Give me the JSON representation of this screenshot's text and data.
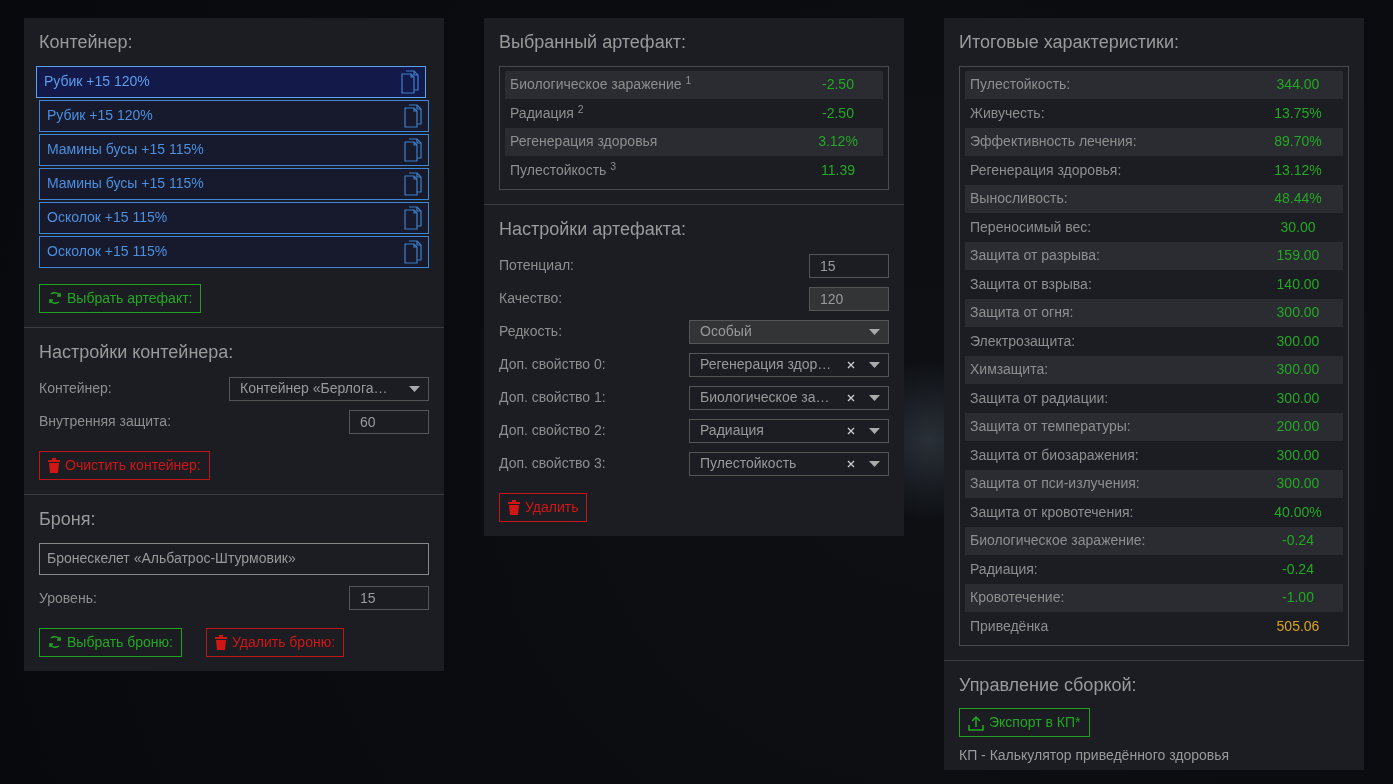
{
  "container_panel": {
    "title": "Контейнер:",
    "artifacts": [
      {
        "label": "Рубик +15 120%",
        "selected": true
      },
      {
        "label": "Рубик +15 120%",
        "selected": false
      },
      {
        "label": "Мамины бусы +15 115%",
        "selected": false
      },
      {
        "label": "Мамины бусы +15 115%",
        "selected": false
      },
      {
        "label": "Осколок +15 115%",
        "selected": false
      },
      {
        "label": "Осколок +15 115%",
        "selected": false
      }
    ],
    "choose_button": "Выбрать артефакт:"
  },
  "container_settings": {
    "title": "Настройки контейнера:",
    "fields": [
      {
        "kind": "select",
        "label": "Контейнер:",
        "value": "Контейнер «Берлога…",
        "clearable": false,
        "disabled": false
      },
      {
        "kind": "input",
        "label": "Внутренняя защита:",
        "value": "60",
        "disabled": false
      }
    ],
    "clear_button": "Очистить контейнер:"
  },
  "armor": {
    "title": "Броня:",
    "name": "Бронескелет «Альбатрос-Штурмовик»",
    "level_label": "Уровень:",
    "level_value": "15",
    "choose_button": "Выбрать броню:",
    "delete_button": "Удалить броню:"
  },
  "selected_artifact": {
    "title": "Выбранный артефакт:",
    "stats": [
      {
        "label": "Биологическое заражение $^{1}$",
        "value": "-2.50"
      },
      {
        "label": "Радиация $^{2}$",
        "value": "-2.50"
      },
      {
        "label": "Регенерация здоровья",
        "value": "3.12%"
      },
      {
        "label": "Пулестойкость $^{3}$",
        "value": "11.39"
      }
    ]
  },
  "artifact_settings": {
    "title": "Настройки артефакта:",
    "fields": [
      {
        "kind": "input",
        "label": "Потенциал:",
        "value": "15",
        "disabled": false
      },
      {
        "kind": "input",
        "label": "Качество:",
        "value": "120",
        "disabled": true
      },
      {
        "kind": "select",
        "label": "Редкость:",
        "value": "Особый",
        "clearable": false,
        "disabled": true
      },
      {
        "kind": "select",
        "label": "Доп. свойство 0:",
        "value": "Регенерация здор…",
        "clearable": true,
        "disabled": false
      },
      {
        "kind": "select",
        "label": "Доп. свойство 1:",
        "value": "Биологическое за…",
        "clearable": true,
        "disabled": false
      },
      {
        "kind": "select",
        "label": "Доп. свойство 2:",
        "value": "Радиация",
        "clearable": true,
        "disabled": false
      },
      {
        "kind": "select",
        "label": "Доп. свойство 3:",
        "value": "Пулестойкость",
        "clearable": true,
        "disabled": false
      }
    ],
    "delete_button": "Удалить"
  },
  "totals": {
    "title": "Итоговые характеристики:",
    "stats": [
      {
        "label": "Пулестойкость:",
        "value": "344.00",
        "kind": "stat"
      },
      {
        "label": "Живучесть:",
        "value": "13.75%",
        "kind": "stat"
      },
      {
        "label": "Эффективность лечения:",
        "value": "89.70%",
        "kind": "stat"
      },
      {
        "label": "Регенерация здоровья:",
        "value": "13.12%",
        "kind": "stat"
      },
      {
        "label": "Выносливость:",
        "value": "48.44%",
        "kind": "stat"
      },
      {
        "label": "Переносимый вес:",
        "value": "30.00",
        "kind": "stat"
      },
      {
        "label": "Защита от разрыва:",
        "value": "159.00",
        "kind": "stat"
      },
      {
        "label": "Защита от взрыва:",
        "value": "140.00",
        "kind": "stat"
      },
      {
        "label": "Защита от огня:",
        "value": "300.00",
        "kind": "stat"
      },
      {
        "label": "Электрозащита:",
        "value": "300.00",
        "kind": "stat"
      },
      {
        "label": "Химзащита:",
        "value": "300.00",
        "kind": "stat"
      },
      {
        "label": "Защита от радиации:",
        "value": "300.00",
        "kind": "stat"
      },
      {
        "label": "Защита от температуры:",
        "value": "200.00",
        "kind": "stat"
      },
      {
        "label": "Защита от биозаражения:",
        "value": "300.00",
        "kind": "stat"
      },
      {
        "label": "Защита от пси-излучения:",
        "value": "300.00",
        "kind": "stat"
      },
      {
        "label": "Защита от кровотечения:",
        "value": "40.00%",
        "kind": "stat"
      },
      {
        "label": "Биологическое заражение:",
        "value": "-0.24",
        "kind": "stat"
      },
      {
        "label": "Радиация:",
        "value": "-0.24",
        "kind": "stat"
      },
      {
        "label": "Кровотечение:",
        "value": "-1.00",
        "kind": "stat"
      },
      {
        "label": "Приведёнка",
        "value": "505.06",
        "kind": "total"
      }
    ]
  },
  "build": {
    "title": "Управление сборкой:",
    "export_button": "Экспорт в КП*",
    "footnote": "КП - Калькулятор приведённого здоровья"
  }
}
